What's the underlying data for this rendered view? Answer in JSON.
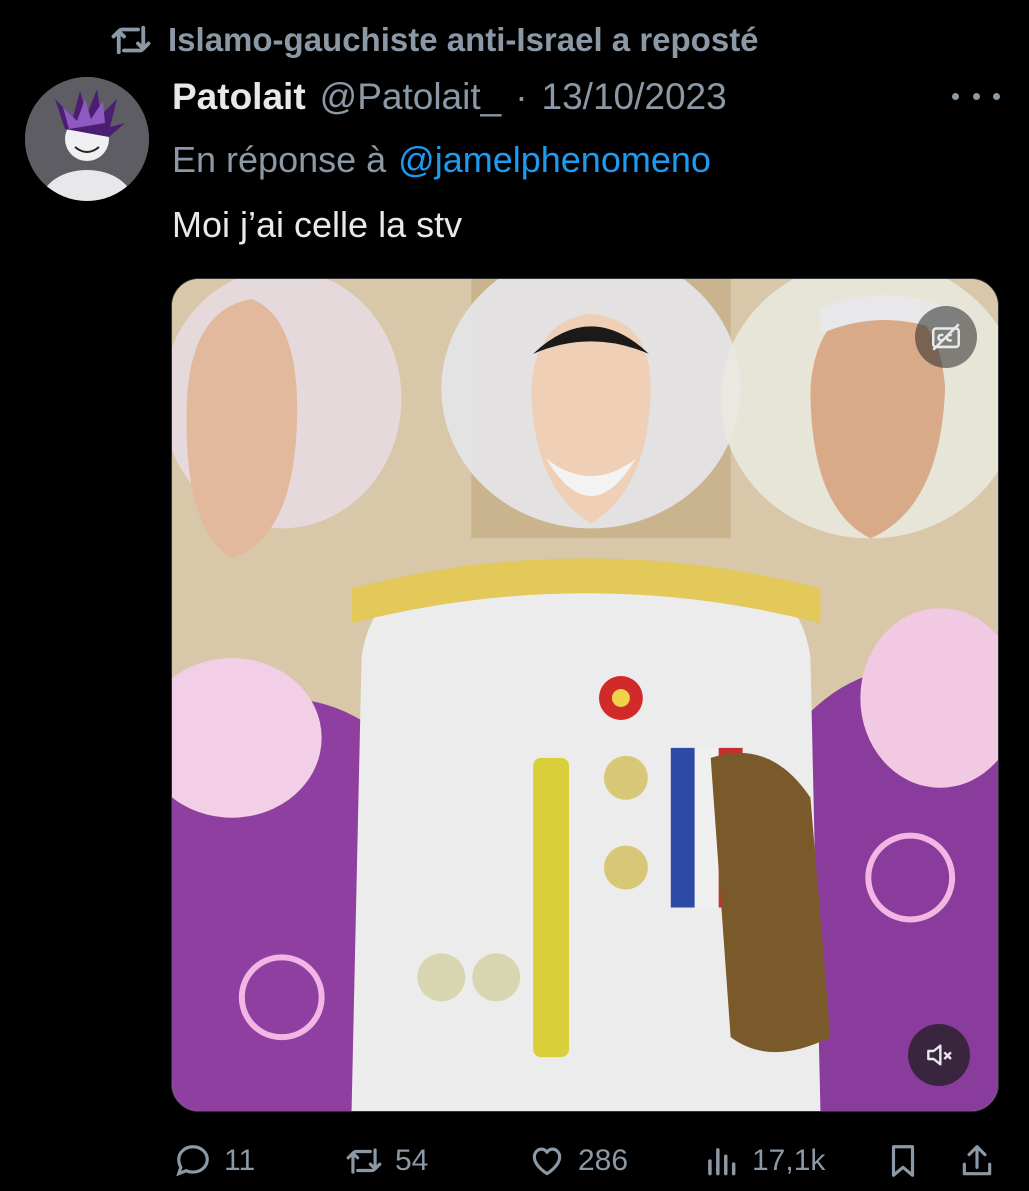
{
  "repost": {
    "text": "Islamo-gauchiste anti-Israel a reposté"
  },
  "tweet": {
    "display_name": "Patolait",
    "handle": "@Patolait_",
    "separator": "·",
    "date": "13/10/2023",
    "reply_prefix": "En réponse à",
    "reply_to": "@jamelphenomeno",
    "text": "Moi j’ai celle la stv"
  },
  "actions": {
    "replies": "11",
    "reposts": "54",
    "likes": "286",
    "views": "17,1k"
  },
  "colors": {
    "muted": "#8b98a5",
    "link": "#1d9bf0",
    "text": "#e7e9ea",
    "background": "#000000"
  }
}
